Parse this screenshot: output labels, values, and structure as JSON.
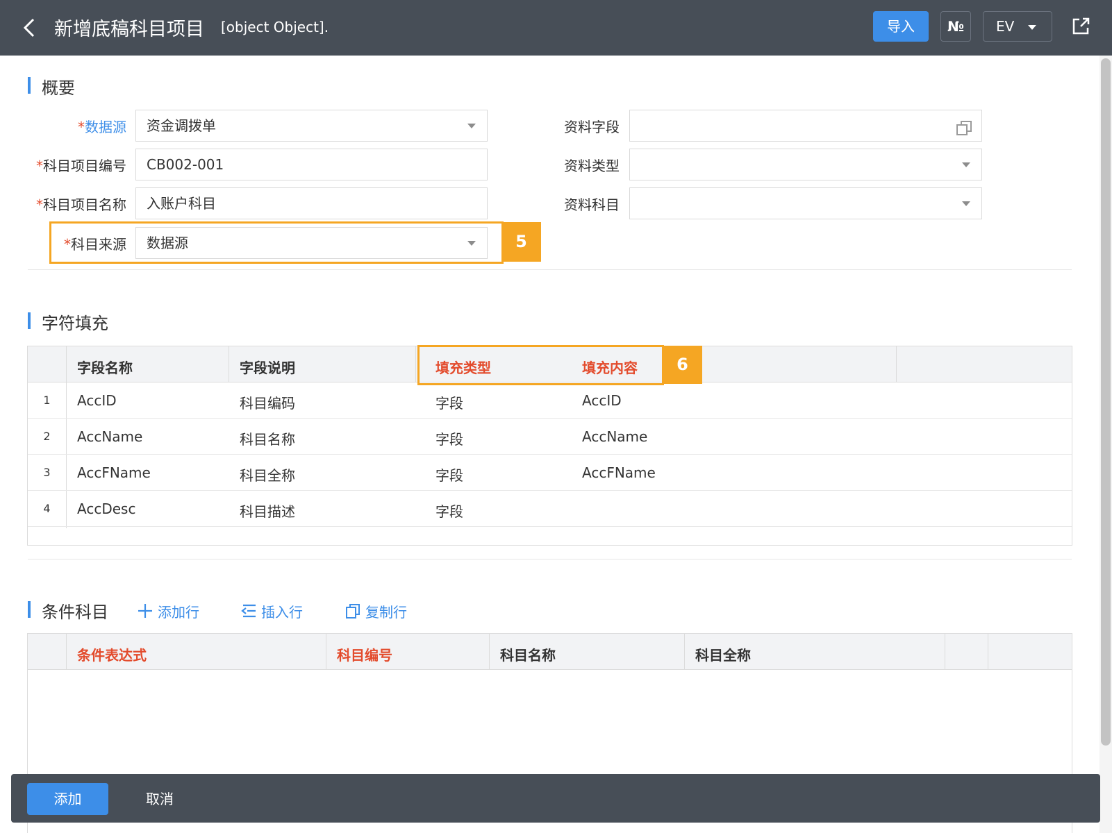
{
  "header": {
    "title": "新增底稿科目项目",
    "subtitle": "[object Object].",
    "import_label": "导入",
    "no_label": "№",
    "lang_label": "EV"
  },
  "overview": {
    "section_title": "概要",
    "datasource": {
      "label": "数据源",
      "value": "资金调拨单"
    },
    "item_code": {
      "label": "科目项目编号",
      "value": "CB002-001"
    },
    "item_name": {
      "label": "科目项目名称",
      "value": "入账户科目"
    },
    "item_source": {
      "label": "科目来源",
      "value": "数据源"
    },
    "doc_field": {
      "label": "资料字段",
      "value": ""
    },
    "doc_type": {
      "label": "资料类型",
      "value": ""
    },
    "doc_subject": {
      "label": "资料科目",
      "value": ""
    },
    "required_mark": "*"
  },
  "annotations": {
    "tag5": "5",
    "tag6": "6"
  },
  "char_fill": {
    "section_title": "字符填充",
    "columns": [
      "字段名称",
      "字段说明",
      "填充类型",
      "填充内容"
    ],
    "rows": [
      {
        "num": "1",
        "name": "AccID",
        "desc": "科目编码",
        "type": "字段",
        "content": "AccID"
      },
      {
        "num": "2",
        "name": "AccName",
        "desc": "科目名称",
        "type": "字段",
        "content": "AccName"
      },
      {
        "num": "3",
        "name": "AccFName",
        "desc": "科目全称",
        "type": "字段",
        "content": "AccFName"
      },
      {
        "num": "4",
        "name": "AccDesc",
        "desc": "科目描述",
        "type": "字段",
        "content": ""
      }
    ]
  },
  "condition": {
    "section_title": "条件科目",
    "add_row": "添加行",
    "insert_row": "插入行",
    "copy_row": "复制行",
    "columns": [
      "条件表达式",
      "科目编号",
      "科目名称",
      "科目全称"
    ]
  },
  "footer": {
    "add_label": "添加",
    "cancel_label": "取消"
  },
  "colors": {
    "header_bg": "#474e57",
    "primary": "#3d8ee8",
    "required": "#e34b2c",
    "highlight": "#f5a623"
  }
}
